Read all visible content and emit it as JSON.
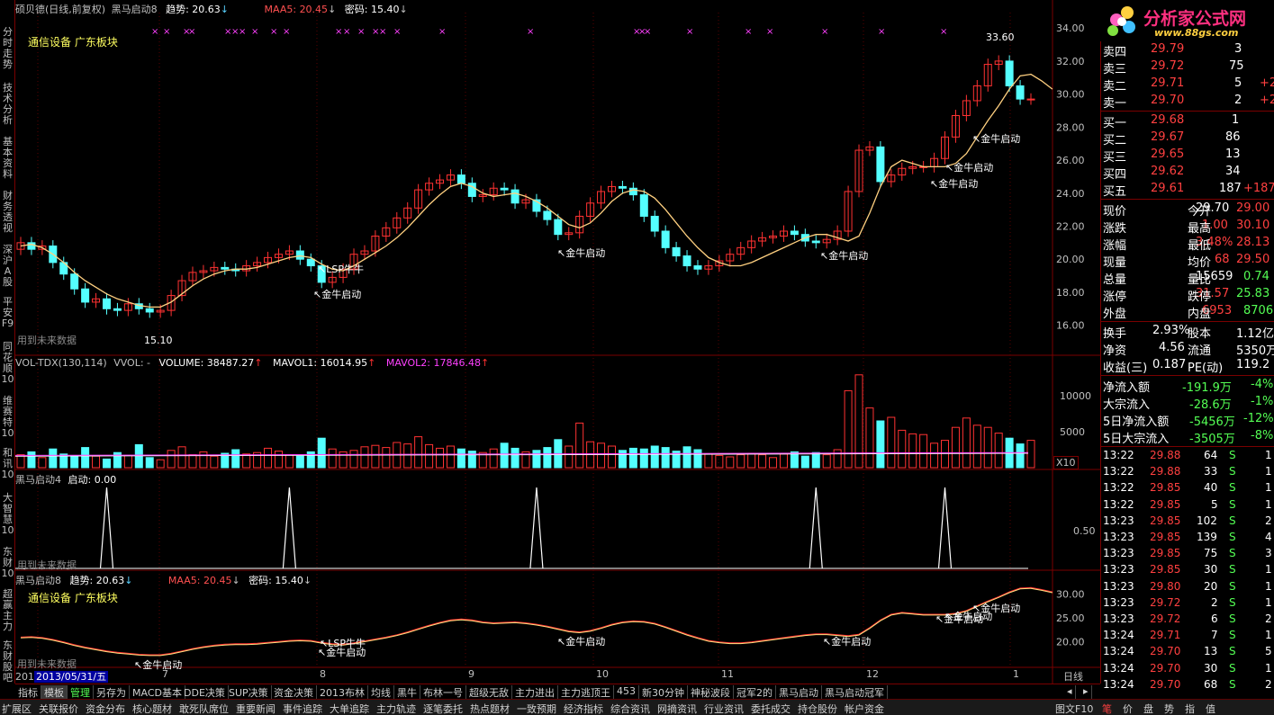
{
  "left_tabs": [
    "分时走势",
    "技术分析",
    "基本资料",
    "财务透视",
    "深沪A股",
    "平安F9",
    "同花顺10",
    "维赛特10",
    "和讯10",
    "大智慧10",
    "东财10",
    "超赢主力",
    "东财股吧"
  ],
  "panel1": {
    "stock": "硕贝德(日线,前复权)",
    "indicator": "黑马启动8",
    "trend_label": "趋势: 20.63",
    "maa_label": "MAA5: 20.45",
    "code_label": "密码: 15.40",
    "sector": "通信设备 广东板块",
    "future_note": "用到未来数据",
    "high_label": "33.60",
    "low_label": "15.10",
    "y_ticks": [
      "34.00",
      "32.00",
      "30.00",
      "28.00",
      "26.00",
      "24.00",
      "22.00",
      "20.00",
      "18.00",
      "16.00"
    ],
    "annotations": [
      "LSP牛牛",
      "金牛启动",
      "金牛启动",
      "金牛启动",
      "金牛启动",
      "金牛启动",
      "金牛启动"
    ]
  },
  "panel2": {
    "title": "VOL-TDX(130,114)",
    "vvol": "VVOL: -",
    "volume": "VOLUME: 38487.27",
    "mavol1": "MAVOL1: 16014.95",
    "mavol2": "MAVOL2: 17846.48",
    "y_ticks": [
      "10000",
      "5000"
    ],
    "unit": "X10"
  },
  "panel3": {
    "title": "黑马启动4",
    "value": "启动: 0.00",
    "y_tick": "0.50",
    "future_note": "用到未来数据"
  },
  "panel4": {
    "indicator": "黑马启动8",
    "trend_label": "趋势: 20.63",
    "maa_label": "MAA5: 20.45",
    "code_label": "密码: 15.40",
    "sector": "通信设备 广东板块",
    "future_note": "用到未来数据",
    "y_ticks": [
      "30.00",
      "25.00",
      "20.00"
    ],
    "annotations": [
      "LSP牛牛",
      "金牛启动",
      "金牛启动",
      "金牛启动",
      "金牛启动",
      "金牛启动",
      "金牛启动",
      "金牛启动"
    ]
  },
  "x_axis": {
    "start": "201",
    "date": "2013/05/31/五",
    "months": [
      "7",
      "8",
      "9",
      "10",
      "11",
      "12",
      "1"
    ],
    "period": "日线"
  },
  "chart_data": {
    "type": "line",
    "ylim": [
      15,
      34.5
    ],
    "series": [
      {
        "values": [
          20.8,
          20.9,
          20.7,
          20.3,
          19.8,
          19.2,
          18.7,
          18.3,
          17.9,
          17.6,
          17.4,
          17.2,
          17.1,
          17.1,
          17.4,
          17.9,
          18.4,
          18.8,
          19.1,
          19.3,
          19.4,
          19.4,
          19.5,
          19.7,
          19.9,
          20.1,
          20.2,
          20.1,
          19.7,
          19.4,
          19.3,
          19.6,
          20.0,
          20.4,
          20.8,
          21.3,
          21.9,
          22.6,
          23.3,
          23.9,
          24.4,
          24.6,
          24.4,
          24.0,
          23.8,
          23.9,
          24.0,
          23.8,
          23.5,
          23.1,
          22.6,
          22.1,
          21.9,
          22.2,
          22.8,
          23.5,
          24.0,
          24.2,
          24.1,
          23.7,
          23.0,
          22.2,
          21.4,
          20.7,
          20.1,
          19.8,
          19.6,
          19.6,
          19.8,
          20.1,
          20.4,
          20.7,
          21.0,
          21.3,
          21.5,
          21.5,
          21.3,
          21.1,
          21.4,
          22.8,
          24.4,
          25.6,
          26.0,
          25.8,
          25.6,
          25.6,
          25.6,
          25.8,
          26.4,
          27.4,
          28.4,
          29.3,
          30.3,
          31.1,
          31.2,
          30.8,
          30.3
        ]
      }
    ]
  },
  "candle_data": {
    "close": [
      21.0,
      20.6,
      20.8,
      19.8,
      19.1,
      18.2,
      17.4,
      17.6,
      17.0,
      16.9,
      17.3,
      17.0,
      16.8,
      16.9,
      17.8,
      18.7,
      19.2,
      19.3,
      19.5,
      19.4,
      19.3,
      19.6,
      19.8,
      20.1,
      20.3,
      20.5,
      20.0,
      19.6,
      18.6,
      18.9,
      19.4,
      20.3,
      20.5,
      21.4,
      21.9,
      22.5,
      23.1,
      24.2,
      24.6,
      24.8,
      25.1,
      24.6,
      23.8,
      23.9,
      24.3,
      24.2,
      23.4,
      23.6,
      22.9,
      22.4,
      21.5,
      21.6,
      22.6,
      23.4,
      24.1,
      24.4,
      24.3,
      23.9,
      22.6,
      21.7,
      20.7,
      20.2,
      19.6,
      19.4,
      19.6,
      19.9,
      20.3,
      20.7,
      21.1,
      21.3,
      21.4,
      21.7,
      21.5,
      21.1,
      21.0,
      21.2,
      21.7,
      24.1,
      26.6,
      26.8,
      24.7,
      25.1,
      25.5,
      25.6,
      25.6,
      26.1,
      27.4,
      28.7,
      29.6,
      30.5,
      31.8,
      32.0,
      30.5,
      29.7,
      29.7
    ],
    "open": [
      20.6,
      21.0,
      20.6,
      20.8,
      19.8,
      19.1,
      18.2,
      17.4,
      17.6,
      17.0,
      16.9,
      17.3,
      17.0,
      16.8,
      16.9,
      17.8,
      18.7,
      19.2,
      19.3,
      19.5,
      19.4,
      19.3,
      19.6,
      19.8,
      20.1,
      20.3,
      20.5,
      20.0,
      19.6,
      18.6,
      18.9,
      19.4,
      20.3,
      20.5,
      21.4,
      21.9,
      22.5,
      23.1,
      24.2,
      24.6,
      24.8,
      25.1,
      24.6,
      23.8,
      23.9,
      24.3,
      24.2,
      23.4,
      23.6,
      22.9,
      22.4,
      21.5,
      21.6,
      22.6,
      23.4,
      24.1,
      24.4,
      24.3,
      23.9,
      22.6,
      21.7,
      20.7,
      20.2,
      19.6,
      19.4,
      19.6,
      19.9,
      20.3,
      20.7,
      21.1,
      21.3,
      21.4,
      21.7,
      21.5,
      21.1,
      21.0,
      21.2,
      21.7,
      24.1,
      26.6,
      26.8,
      24.7,
      25.1,
      25.5,
      25.6,
      25.6,
      26.1,
      27.4,
      28.7,
      29.6,
      30.5,
      31.8,
      32.0,
      30.5,
      29.7
    ],
    "volume": [
      1800,
      2200,
      1400,
      2600,
      1900,
      1500,
      2800,
      1600,
      1200,
      2100,
      1700,
      3200,
      1400,
      1100,
      2400,
      2900,
      1800,
      2200,
      1600,
      2000,
      2500,
      1900,
      2100,
      2700,
      2300,
      1800,
      1600,
      2200,
      4100,
      2600,
      2200,
      2400,
      2900,
      3100,
      2800,
      3500,
      3300,
      4300,
      3200,
      2700,
      3000,
      2600,
      2300,
      2100,
      2600,
      3400,
      2700,
      2200,
      2400,
      2800,
      3900,
      3000,
      6200,
      3600,
      3400,
      3000,
      2400,
      2700,
      2600,
      3000,
      2800,
      2300,
      2900,
      2500,
      1900,
      1700,
      1500,
      1800,
      2000,
      1800,
      1400,
      1900,
      2200,
      1600,
      2100,
      1800,
      2500,
      10700,
      12900,
      8300,
      6500,
      7000,
      5200,
      4700,
      4600,
      3400,
      3800,
      5600,
      6900,
      5900,
      5600,
      4800,
      4100,
      3300,
      3800
    ]
  },
  "signals_idx": [
    8,
    25,
    48,
    74,
    86
  ],
  "quote": {
    "sell": [
      [
        "卖四",
        "29.79",
        "3",
        ""
      ],
      [
        "卖三",
        "29.72",
        "75",
        ""
      ],
      [
        "卖二",
        "29.71",
        "5",
        "+2"
      ],
      [
        "卖一",
        "29.70",
        "2",
        "+2"
      ]
    ],
    "buy": [
      [
        "买一",
        "29.68",
        "1",
        ""
      ],
      [
        "买二",
        "29.67",
        "86",
        ""
      ],
      [
        "买三",
        "29.65",
        "13",
        ""
      ],
      [
        "买四",
        "29.62",
        "34",
        ""
      ],
      [
        "买五",
        "29.61",
        "187",
        "+187"
      ]
    ],
    "stats": [
      [
        "现价",
        "29.70",
        "今开",
        "29.00"
      ],
      [
        "涨跌",
        "1.00",
        "最高",
        "30.10"
      ],
      [
        "涨幅",
        "3.48%",
        "最低",
        "28.13"
      ],
      [
        "现量",
        "68",
        "均价",
        "29.50"
      ],
      [
        "总量",
        "15659",
        "量比",
        "0.74"
      ],
      [
        "涨停",
        "31.57",
        "跌停",
        "25.83"
      ],
      [
        "外盘",
        "6953",
        "内盘",
        "8706"
      ]
    ],
    "stats2": [
      [
        "换手",
        "2.93%",
        "股本",
        "1.12亿"
      ],
      [
        "净资",
        "4.56",
        "流通",
        "5350万"
      ],
      [
        "收益(三)",
        "0.187",
        "PE(动)",
        "119.2"
      ]
    ],
    "flows": [
      [
        "净流入额",
        "-191.9万",
        "-4%"
      ],
      [
        "大宗流入",
        "-28.6万",
        "-1%"
      ],
      [
        "5日净流入额",
        "-5456万",
        "-12%"
      ],
      [
        "5日大宗流入",
        "-3505万",
        "-8%"
      ]
    ],
    "ticks": [
      [
        "13:22",
        "29.88",
        "64",
        "S",
        "1"
      ],
      [
        "13:22",
        "29.88",
        "33",
        "S",
        "1"
      ],
      [
        "13:22",
        "29.85",
        "40",
        "S",
        "1"
      ],
      [
        "13:22",
        "29.85",
        "5",
        "S",
        "1"
      ],
      [
        "13:23",
        "29.85",
        "102",
        "S",
        "2"
      ],
      [
        "13:23",
        "29.85",
        "139",
        "S",
        "4"
      ],
      [
        "13:23",
        "29.85",
        "75",
        "S",
        "3"
      ],
      [
        "13:23",
        "29.85",
        "30",
        "S",
        "1"
      ],
      [
        "13:23",
        "29.80",
        "20",
        "S",
        "1"
      ],
      [
        "13:23",
        "29.72",
        "2",
        "S",
        "1"
      ],
      [
        "13:23",
        "29.72",
        "6",
        "S",
        "2"
      ],
      [
        "13:24",
        "29.71",
        "7",
        "S",
        "1"
      ],
      [
        "13:24",
        "29.70",
        "13",
        "S",
        "5"
      ],
      [
        "13:24",
        "29.70",
        "30",
        "S",
        "1"
      ],
      [
        "13:24",
        "29.70",
        "68",
        "S",
        "2"
      ]
    ]
  },
  "logo": {
    "title": "分析家公式网",
    "url": "www.88gs.com"
  },
  "bottom_tabs": [
    "指标",
    "模板",
    "管理",
    "另存为",
    "MACD基本",
    "DDE决策",
    "SUP决策",
    "资金决策",
    "2013布林",
    "均线",
    "黑牛",
    "布林一号",
    "超级无敌",
    "主力进出",
    "主力逃顶王",
    "453",
    "新30分钟",
    "神秘波段",
    "冠军2的",
    "黑马启动",
    "黑马启动冠军"
  ],
  "bottom_bar": [
    "扩展区",
    "关联报价",
    "资金分布",
    "核心题材",
    "敢死队席位",
    "重要新闻",
    "事件追踪",
    "大单追踪",
    "主力轨迹",
    "逐笔委托",
    "热点题材",
    "一致预期",
    "经济指标",
    "综合资讯",
    "网摘资讯",
    "行业资讯",
    "委托成交",
    "持仓股份",
    "帐户资金"
  ],
  "bottom_right": [
    "图文F10",
    "笔",
    "价",
    "盘",
    "势",
    "指",
    "值"
  ]
}
